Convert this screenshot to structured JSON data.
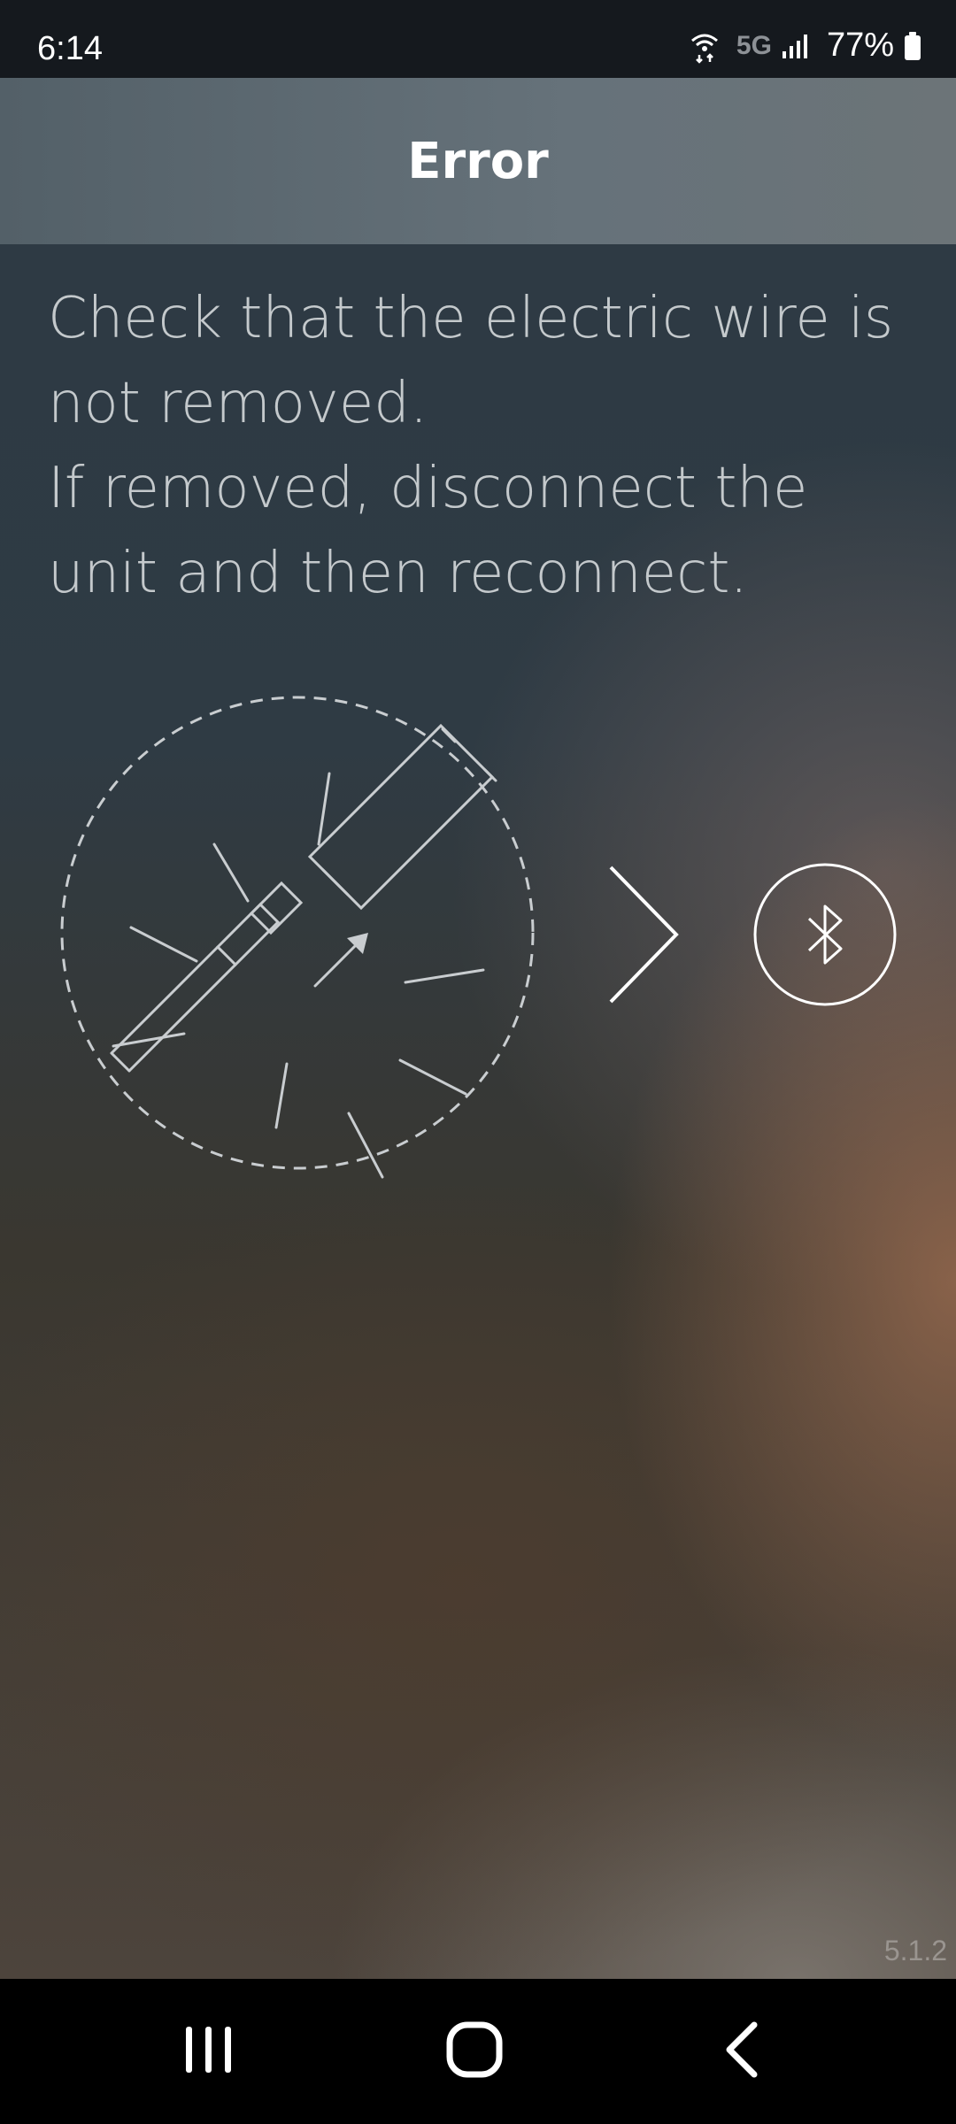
{
  "status_bar": {
    "time": "6:14",
    "network": "5G",
    "battery": "77%",
    "icons": [
      "wifi-calling-icon",
      "signal-bars-icon",
      "battery-icon"
    ]
  },
  "header": {
    "title": "Error"
  },
  "message": {
    "line1": "Check that the electric wire is",
    "line2": "not removed.",
    "line3": "If removed, disconnect the",
    "line4": "unit and then reconnect."
  },
  "illustration": {
    "icons": [
      "cable-disconnect-icon",
      "chevron-right-icon",
      "bluetooth-icon"
    ]
  },
  "version": "5.1.2",
  "nav_bar": {
    "icons": [
      "recent-apps-icon",
      "home-icon",
      "back-icon"
    ]
  },
  "colors": {
    "status_bar_bg": "#15191e",
    "header_bg": "#5f6b72",
    "message_text": "#c4c9cc",
    "nav_bar_bg": "#000000"
  }
}
